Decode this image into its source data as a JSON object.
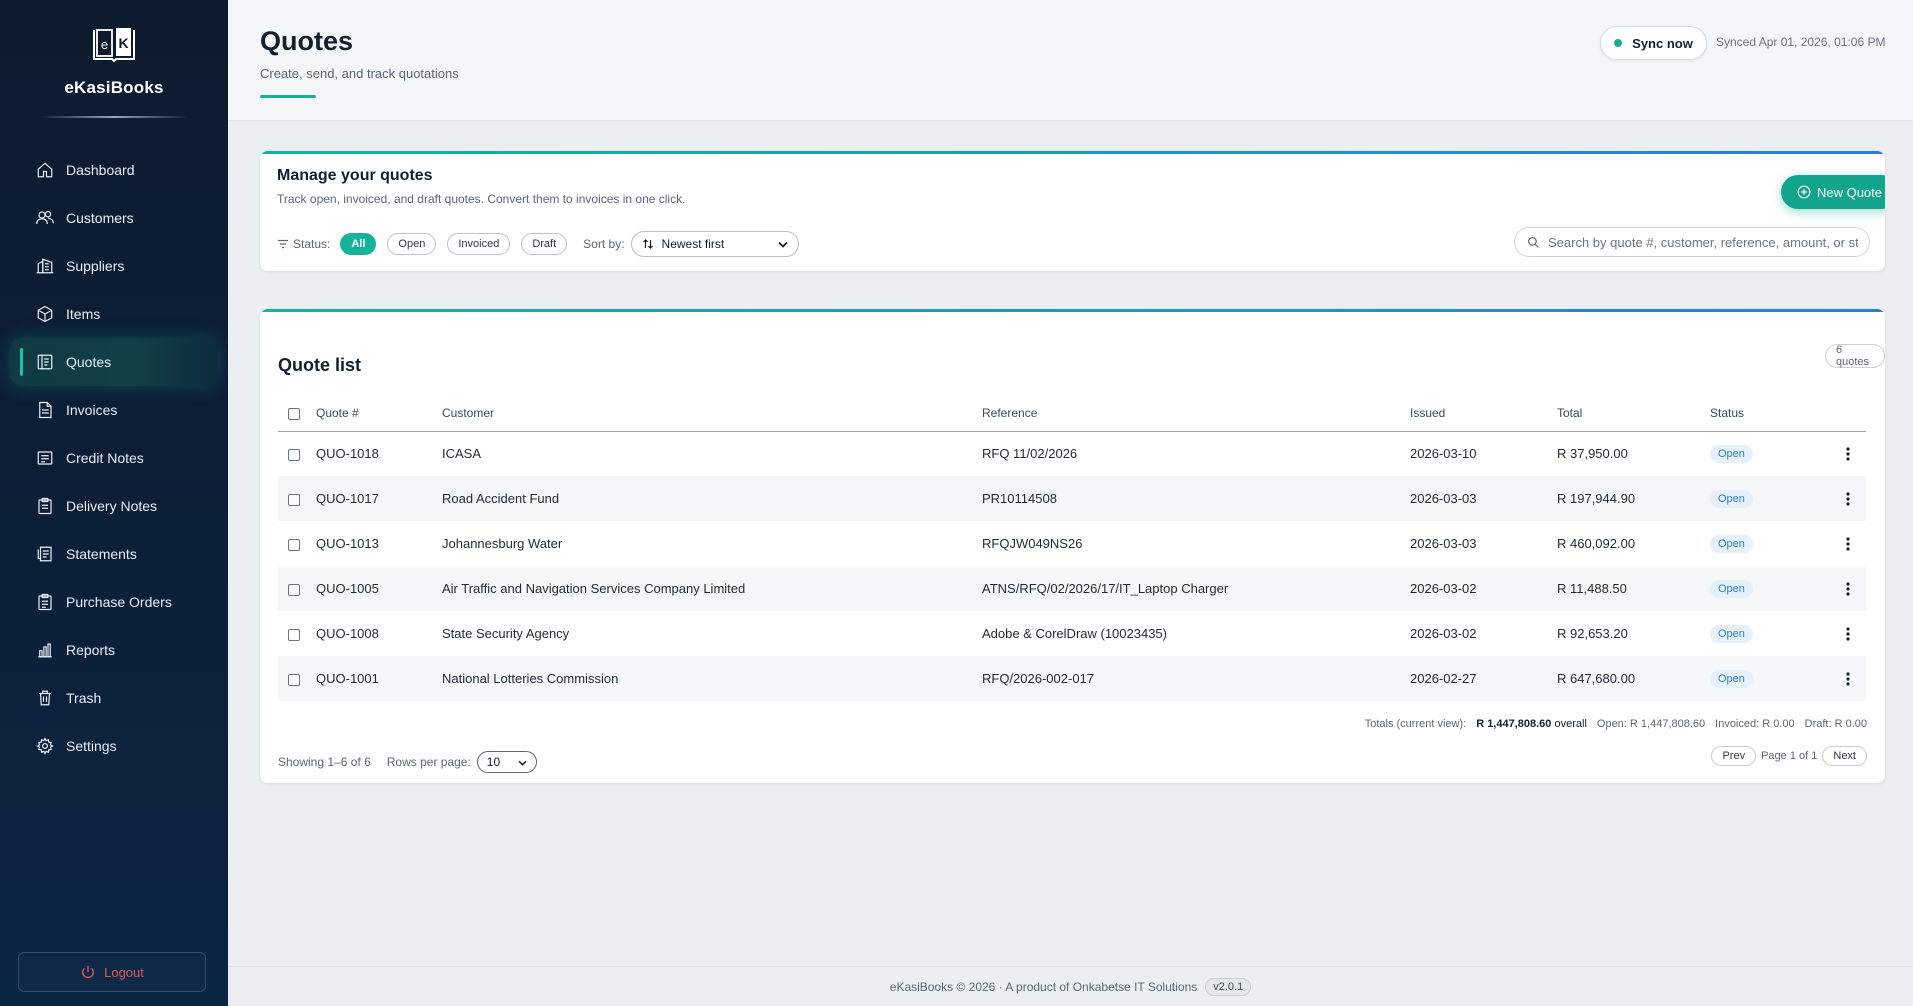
{
  "brand": {
    "name": "eKasiBooks",
    "logo_letters": [
      "e",
      "K"
    ]
  },
  "sidebar": {
    "items": [
      {
        "label": "Dashboard",
        "icon": "home-icon"
      },
      {
        "label": "Customers",
        "icon": "users-icon"
      },
      {
        "label": "Suppliers",
        "icon": "building-icon"
      },
      {
        "label": "Items",
        "icon": "box-icon"
      },
      {
        "label": "Quotes",
        "icon": "document-icon"
      },
      {
        "label": "Invoices",
        "icon": "invoice-icon"
      },
      {
        "label": "Credit Notes",
        "icon": "receipt-icon"
      },
      {
        "label": "Delivery Notes",
        "icon": "clipboard-icon"
      },
      {
        "label": "Statements",
        "icon": "statement-icon"
      },
      {
        "label": "Purchase Orders",
        "icon": "clipboard-list-icon"
      },
      {
        "label": "Reports",
        "icon": "bar-chart-icon"
      },
      {
        "label": "Trash",
        "icon": "trash-icon"
      },
      {
        "label": "Settings",
        "icon": "gear-icon"
      }
    ],
    "active": "Quotes",
    "logout_label": "Logout"
  },
  "header": {
    "title": "Quotes",
    "subtitle": "Create, send, and track quotations",
    "sync_label": "Sync now",
    "sync_status": "Synced Apr 01, 2026, 01:06 PM"
  },
  "manage": {
    "title": "Manage your quotes",
    "subtitle": "Track open, invoiced, and draft quotes. Convert them to invoices in one click.",
    "new_quote_label": "New Quote",
    "status_label": "Status:",
    "status_chips": [
      "All",
      "Open",
      "Invoiced",
      "Draft"
    ],
    "active_status": "All",
    "sort_label": "Sort by:",
    "sort_value": "Newest first",
    "search_placeholder": "Search by quote #, customer, reference, amount, or status"
  },
  "quote_list": {
    "title": "Quote list",
    "count_badge": "6 quotes",
    "columns": [
      "Quote #",
      "Customer",
      "Reference",
      "Issued",
      "Total",
      "Status"
    ],
    "rows": [
      {
        "quote": "QUO-1018",
        "customer": "ICASA",
        "reference": "RFQ 11/02/2026",
        "issued": "2026-03-10",
        "total": "R 37,950.00",
        "status": "Open"
      },
      {
        "quote": "QUO-1017",
        "customer": "Road Accident Fund",
        "reference": "PR10114508",
        "issued": "2026-03-03",
        "total": "R 197,944.90",
        "status": "Open"
      },
      {
        "quote": "QUO-1013",
        "customer": "Johannesburg Water",
        "reference": "RFQJW049NS26",
        "issued": "2026-03-03",
        "total": "R 460,092.00",
        "status": "Open"
      },
      {
        "quote": "QUO-1005",
        "customer": "Air Traffic and Navigation Services Company Limited",
        "reference": "ATNS/RFQ/02/2026/17/IT_Laptop Charger",
        "issued": "2026-03-02",
        "total": "R 11,488.50",
        "status": "Open"
      },
      {
        "quote": "QUO-1008",
        "customer": "State Security Agency",
        "reference": "Adobe & CorelDraw (10023435)",
        "issued": "2026-03-02",
        "total": "R 92,653.20",
        "status": "Open"
      },
      {
        "quote": "QUO-1001",
        "customer": "National Lotteries Commission",
        "reference": "RFQ/2026-002-017",
        "issued": "2026-02-27",
        "total": "R 647,680.00",
        "status": "Open"
      }
    ],
    "totals": {
      "label": "Totals (current view):",
      "overall_value": "R 1,447,808.60",
      "overall_suffix": "overall",
      "open": "Open: R 1,447,808.60",
      "invoiced": "Invoiced: R 0.00",
      "draft": "Draft: R 0.00"
    },
    "showing": "Showing 1–6 of 6",
    "rows_per_page_label": "Rows per page:",
    "rows_per_page_value": "10",
    "prev_label": "Prev",
    "page_info": "Page 1 of 1",
    "next_label": "Next"
  },
  "footer": {
    "text": "eKasiBooks © 2026 · A product of Onkabetse IT Solutions",
    "version": "v2.0.1"
  },
  "colors": {
    "accent": "#15b39a",
    "sidebar_bg": "#0d1b2e",
    "status_open": "#2b7fd8",
    "logout": "#e05a5a"
  }
}
